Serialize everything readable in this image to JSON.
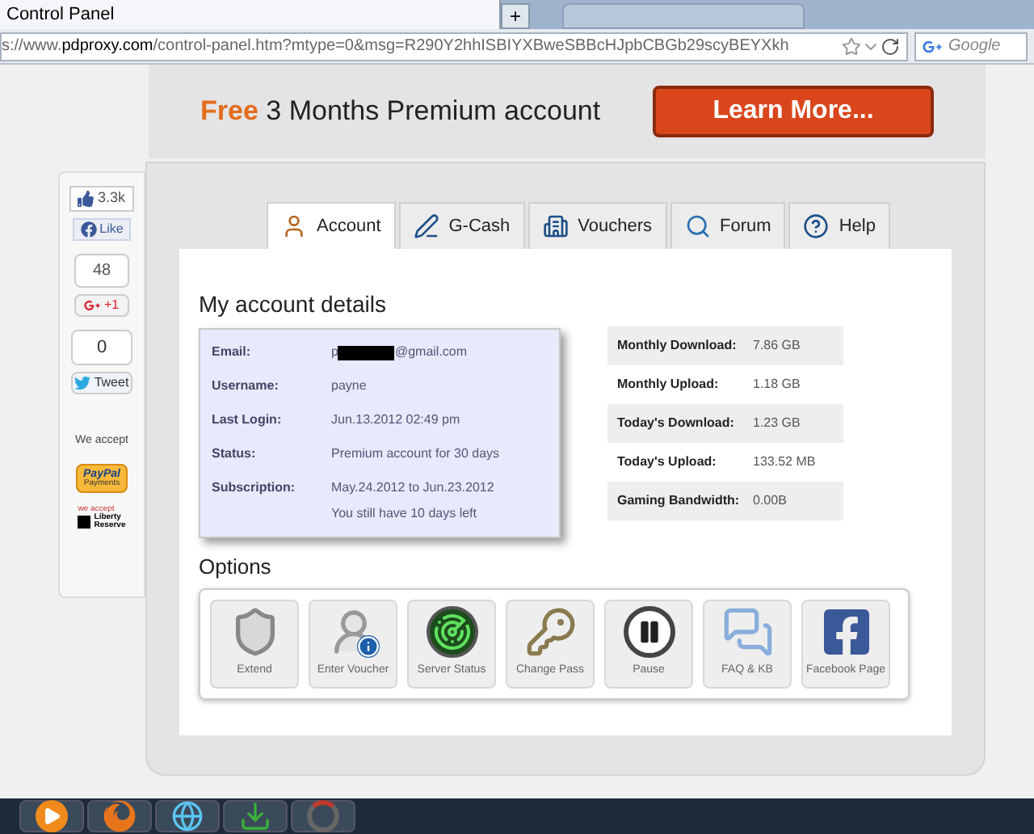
{
  "browser": {
    "tab_title": "Control Panel",
    "new_tab": "+",
    "url": "s://www.**pdproxy.com**/control-panel.htm?mtype=0&msg=R290Y2hhISBIYXBweSBBcHJpbCBGb29scyBEYXkh",
    "search_placeholder": "Google"
  },
  "banner": {
    "highlight": "Free",
    "text": "3 Months Premium account",
    "button": "Learn More..."
  },
  "sidebar": {
    "like_count": "3.3k",
    "like": "Like",
    "plus_count": "48",
    "plus": "+1",
    "tweet_count": "0",
    "tweet": "Tweet",
    "accept": "We accept",
    "paypal": "PayPal",
    "paypal_sub": "Payments",
    "lr_note": "we accept",
    "lr_name": "Liberty",
    "lr_name2": "Reserve"
  },
  "tabs": [
    {
      "label": "Account",
      "selected": true
    },
    {
      "label": "G-Cash",
      "selected": false
    },
    {
      "label": "Vouchers",
      "selected": false
    },
    {
      "label": "Forum",
      "selected": false
    },
    {
      "label": "Help",
      "selected": false
    }
  ],
  "details": {
    "title": "My account details",
    "rows": [
      {
        "label": "Email:",
        "kind": "redacted",
        "value": "p",
        "value_end": "@gmail.com"
      },
      {
        "label": "Username:",
        "kind": "text",
        "value": "payne"
      },
      {
        "label": "Last Login:",
        "kind": "text",
        "value": "Jun.13.2012 02:49 pm"
      },
      {
        "label": "Status:",
        "kind": "text",
        "value": "Premium account for 30 days"
      },
      {
        "label": "Subscription:",
        "kind": "text",
        "value": "May.24.2012 to Jun.23.2012",
        "value_end": "You still have 10 days left"
      }
    ]
  },
  "usage": [
    {
      "label": "Monthly Download:",
      "value": "7.86 GB"
    },
    {
      "label": "Monthly Upload:",
      "value": "1.18 GB"
    },
    {
      "label": "Today's Download:",
      "value": "1.23 GB"
    },
    {
      "label": "Today's Upload:",
      "value": "133.52 MB"
    },
    {
      "label": "Gaming Bandwidth:",
      "value": "0.00B"
    }
  ],
  "options": {
    "title": "Options",
    "items": [
      {
        "label": "Extend"
      },
      {
        "label": "Enter Voucher"
      },
      {
        "label": "Server Status"
      },
      {
        "label": "Change Pass"
      },
      {
        "label": "Pause"
      },
      {
        "label": "FAQ & KB"
      },
      {
        "label": "Facebook Page"
      }
    ]
  }
}
